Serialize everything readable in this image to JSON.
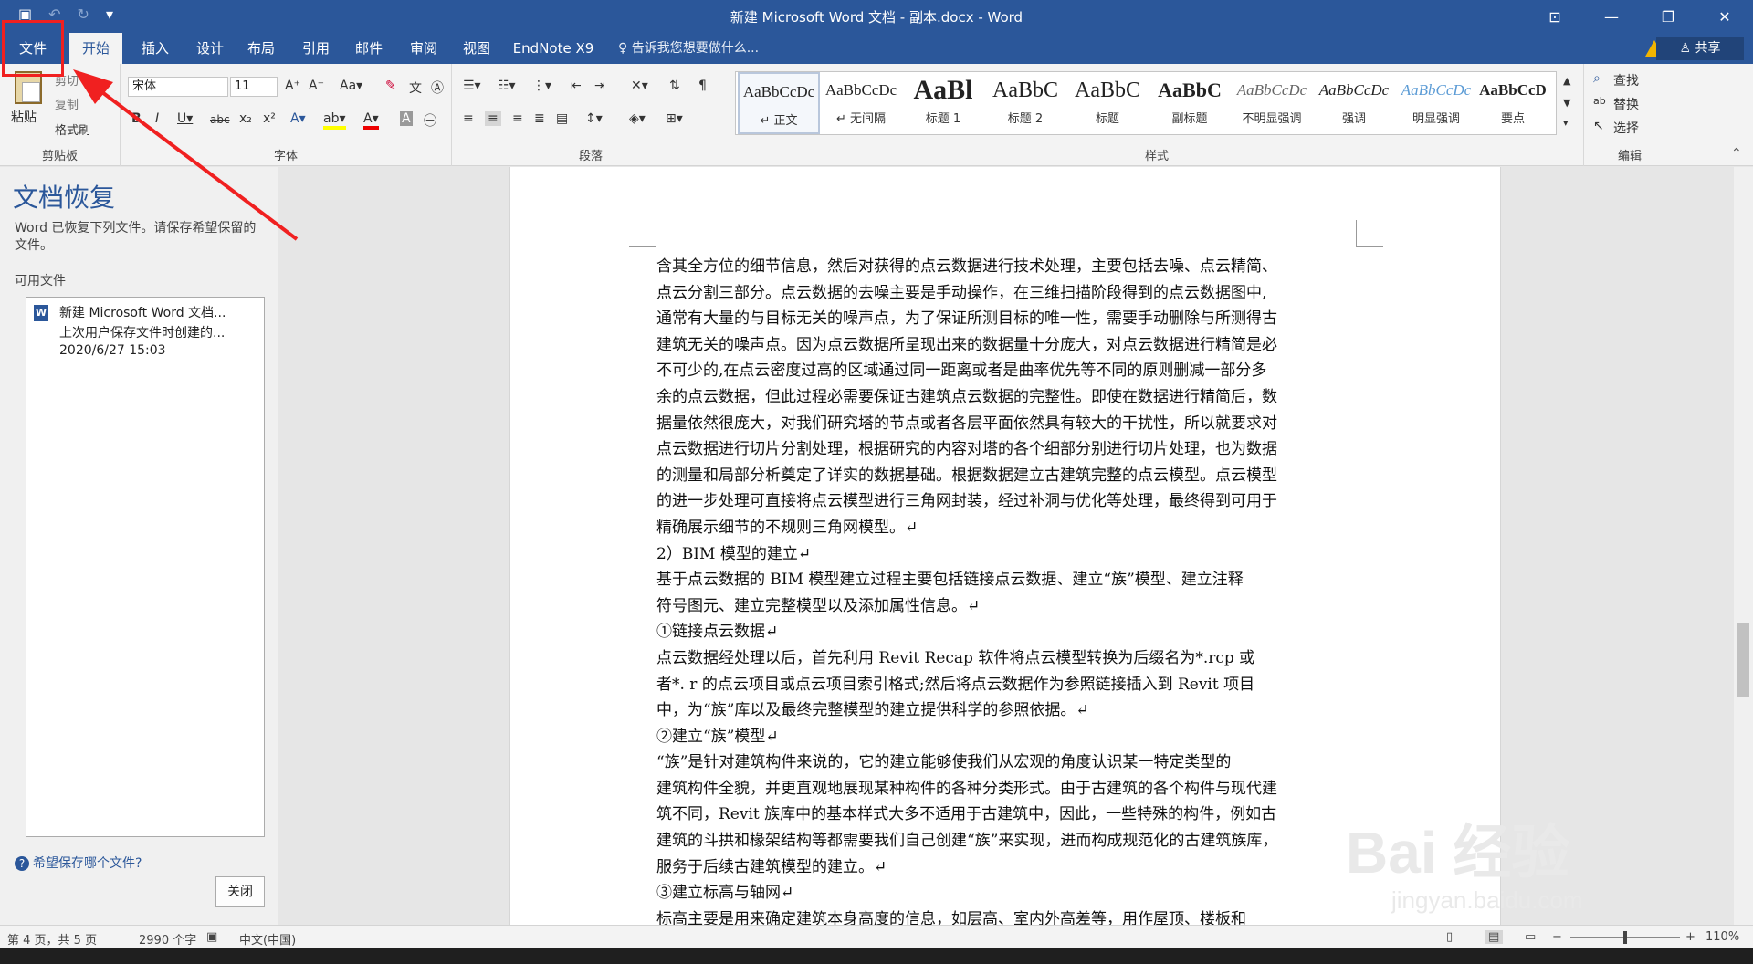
{
  "titlebar": {
    "title": "新建 Microsoft Word 文档 - 副本.docx - Word",
    "qat": {
      "save": "▣",
      "undo": "↶",
      "redo": "↻",
      "customize": "▾"
    },
    "controls": {
      "ribbon_options": "⊡",
      "minimize": "—",
      "restore": "❐",
      "close": "✕"
    }
  },
  "tabs": {
    "file": "文件",
    "items": [
      "开始",
      "插入",
      "设计",
      "布局",
      "引用",
      "邮件",
      "审阅",
      "视图",
      "EndNote X9"
    ],
    "tellme": "♀ 告诉我您想要做什么...",
    "share": "♙ 共享"
  },
  "ribbon": {
    "clipboard": {
      "paste": "粘贴",
      "cut": "剪切",
      "copy": "复制",
      "format_painter": "格式刷",
      "label": "剪贴板"
    },
    "font": {
      "name": "宋体",
      "size": "11",
      "label": "字体"
    },
    "paragraph": {
      "label": "段落"
    },
    "styles": {
      "label": "样式",
      "items": [
        {
          "sample": "AaBbCcDc",
          "name": "↵ 正文"
        },
        {
          "sample": "AaBbCcDc",
          "name": "↵ 无间隔"
        },
        {
          "sample": "AaBl",
          "name": "标题 1"
        },
        {
          "sample": "AaBbC",
          "name": "标题 2"
        },
        {
          "sample": "AaBbC",
          "name": "标题"
        },
        {
          "sample": "AaBbC",
          "name": "副标题"
        },
        {
          "sample": "AaBbCcDc",
          "name": "不明显强调"
        },
        {
          "sample": "AaBbCcDc",
          "name": "强调"
        },
        {
          "sample": "AaBbCcDc",
          "name": "明显强调"
        },
        {
          "sample": "AaBbCcD",
          "name": "要点"
        }
      ]
    },
    "editing": {
      "find": "查找",
      "replace": "替换",
      "select": "选择",
      "label": "编辑"
    }
  },
  "recovery": {
    "title": "文档恢复",
    "description": "Word 已恢复下列文件。请保存希望保留的文件。",
    "available_label": "可用文件",
    "file": {
      "name": "新建 Microsoft Word 文档...",
      "note": "上次用户保存文件时创建的...",
      "date": "2020/6/27 15:03"
    },
    "help": "希望保存哪个文件?",
    "close": "关闭"
  },
  "document": {
    "lines": [
      "含其全方位的细节信息，然后对获得的点云数据进行技术处理，主要包括去噪、点云精简、",
      "点云分割三部分。点云数据的去噪主要是手动操作，在三维扫描阶段得到的点云数据图中,",
      "通常有大量的与目标无关的噪声点，为了保证所测目标的唯一性，需要手动删除与所测得古",
      "建筑无关的噪声点。因为点云数据所呈现出来的数据量十分庞大，对点云数据进行精简是必",
      "不可少的,在点云密度过高的区域通过同一距离或者是曲率优先等不同的原则删减一部分多",
      "余的点云数据，但此过程必需要保证古建筑点云数据的完整性。即使在数据进行精简后，数",
      "据量依然很庞大，对我们研究塔的节点或者各层平面依然具有较大的干扰性，所以就要求对",
      "点云数据进行切片分割处理，根据研究的内容对塔的各个细部分别进行切片处理，也为数据",
      "的测量和局部分析奠定了详实的数据基础。根据数据建立古建筑完整的点云模型。点云模型",
      "的进一步处理可直接将点云模型进行三角网封装，经过补洞与优化等处理，最终得到可用于",
      "精确展示细节的不规则三角网模型。↵",
      "2）BIM 模型的建立↵",
      "    基于点云数据的 BIM 模型建立过程主要包括链接点云数据、建立“族”模型、建立注释",
      "符号图元、建立完整模型以及添加属性信息。↵",
      "①链接点云数据↵",
      "    点云数据经处理以后，首先利用 Revit Recap 软件将点云模型转换为后缀名为*.rcp 或",
      "者*. r 的点云项目或点云项目索引格式;然后将点云数据作为参照链接插入到 Revit 项目",
      "中，为“族”库以及最终完整模型的建立提供科学的参照依据。↵",
      "②建立“族”模型↵",
      "    “族”是针对建筑构件来说的，它的建立能够使我们从宏观的角度认识某一特定类型的",
      "建筑构件全貌，并更直观地展现某种构件的各种分类形式。由于古建筑的各个构件与现代建",
      "筑不同，Revit 族库中的基本样式大多不适用于古建筑中，因此，一些特殊的构件，例如古",
      "建筑的斗拱和椽架结构等都需要我们自己创建“族”来实现，进而构成规范化的古建筑族库，",
      "服务于后续古建筑模型的建立。↵",
      "③建立标高与轴网↵",
      "    标高主要是用来确定建筑本身高度的信息，如层高、室内外高差等，用作屋顶、楼板和"
    ]
  },
  "watermark": {
    "main": "Bai  经验",
    "url": "jingyan.baidu.com"
  },
  "status": {
    "page": "第 4 页，共 5 页",
    "words": "2990 个字",
    "language": "中文(中国)",
    "zoom": "110%"
  },
  "colors": {
    "accent": "#2b579a",
    "annotation": "#f02020"
  }
}
